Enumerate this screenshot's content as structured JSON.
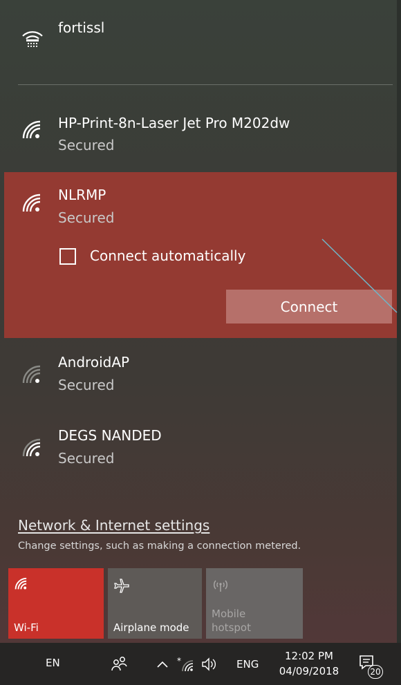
{
  "networks": [
    {
      "ssid": "fortissl",
      "status": "",
      "icon": "wifi-locked-icon"
    },
    {
      "ssid": "HP-Print-8n-Laser Jet Pro M202dw",
      "status": "Secured",
      "icon": "wifi-secured-icon"
    },
    {
      "ssid": "NLRMP",
      "status": "Secured",
      "icon": "wifi-secured-icon",
      "selected": true
    },
    {
      "ssid": "AndroidAP",
      "status": "Secured",
      "icon": "wifi-secured-icon"
    },
    {
      "ssid": "DEGS NANDED",
      "status": "Secured",
      "icon": "wifi-secured-icon"
    }
  ],
  "selected_network": {
    "connect_automatically_label": "Connect automatically",
    "connect_automatically_checked": false,
    "connect_label": "Connect"
  },
  "settings": {
    "link": "Network & Internet settings",
    "description": "Change settings, such as making a connection metered."
  },
  "quick_actions": [
    {
      "label": "Wi-Fi",
      "icon": "wifi-icon",
      "active": true
    },
    {
      "label": "Airplane mode",
      "icon": "airplane-icon",
      "active": false
    },
    {
      "label": "Mobile\nhotspot",
      "label_line1": "Mobile",
      "label_line2": "hotspot",
      "icon": "hotspot-icon",
      "active": false,
      "disabled": true
    }
  ],
  "taskbar": {
    "input_lang": "EN",
    "keyboard_lang": "ENG",
    "time": "12:02 PM",
    "date": "04/09/2018",
    "notification_count": "20"
  },
  "colors": {
    "selected_bg": "#943a32",
    "connect_button": "#b6706a",
    "wifi_tile_active": "#c9312a",
    "taskbar_bg": "#262524"
  }
}
